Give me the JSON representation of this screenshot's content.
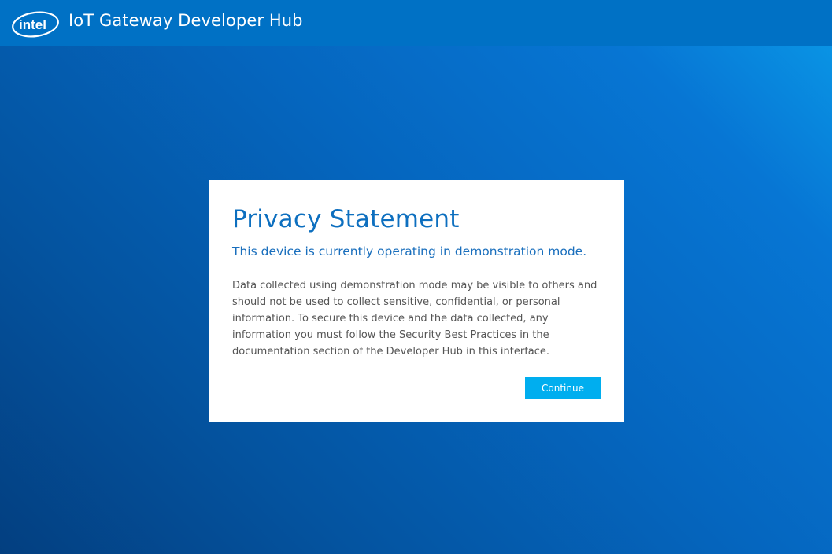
{
  "header": {
    "logo_text": "intel",
    "title": "IoT Gateway Developer Hub"
  },
  "dialog": {
    "title": "Privacy Statement",
    "subtitle": "This device is currently operating in demonstration mode.",
    "body": "Data collected using demonstration mode may be visible to others and should not be used to collect sensitive, confidential, or personal information. To secure this device and the data collected, any information you must follow the Security Best Practices in the documentation section of the Developer Hub in this interface.",
    "continue_label": "Continue"
  },
  "colors": {
    "header_bg": "#0071c5",
    "button_bg": "#00aeef",
    "title_color": "#0d6fbf"
  },
  "icons": {
    "logo": "intel-logo-icon"
  }
}
